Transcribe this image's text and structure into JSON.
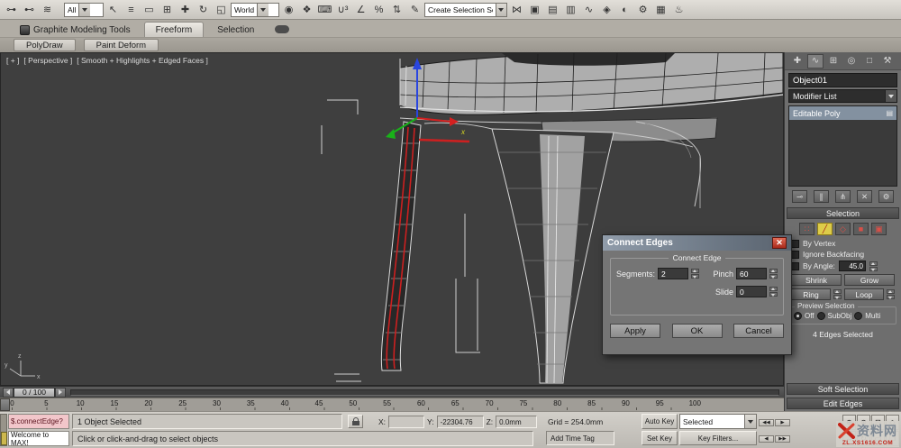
{
  "toolbar": {
    "groups": {
      "g1": [
        {
          "name": "select-and-link-icon",
          "glyph": "⊶"
        },
        {
          "name": "unlink-selection-icon",
          "glyph": "⊷"
        },
        {
          "name": "bind-to-spacewarp-icon",
          "glyph": "≋"
        }
      ],
      "g2": [
        {
          "name": "select-object-icon",
          "glyph": "↖"
        },
        {
          "name": "select-by-name-icon",
          "glyph": "≡"
        },
        {
          "name": "selection-region-icon",
          "glyph": "▭"
        },
        {
          "name": "window-crossing-icon",
          "glyph": "⊞"
        },
        {
          "name": "select-move-icon",
          "glyph": "✚"
        },
        {
          "name": "select-rotate-icon",
          "glyph": "↻"
        },
        {
          "name": "select-scale-icon",
          "glyph": "◱"
        }
      ],
      "g3": [
        {
          "name": "use-pivot-center-icon",
          "glyph": "◉"
        },
        {
          "name": "select-manipulate-icon",
          "glyph": "❖"
        },
        {
          "name": "keyboard-override-icon",
          "glyph": "⌨"
        },
        {
          "name": "snap-toggle-3d-icon",
          "glyph": "∪³"
        },
        {
          "name": "angle-snap-icon",
          "glyph": "∠"
        },
        {
          "name": "percent-snap-icon",
          "glyph": "%"
        },
        {
          "name": "spinner-snap-icon",
          "glyph": "⇅"
        },
        {
          "name": "named-selection-sets-icon",
          "glyph": "✎"
        }
      ],
      "g4": [
        {
          "name": "mirror-icon",
          "glyph": "⋈"
        },
        {
          "name": "align-icon",
          "glyph": "▣"
        },
        {
          "name": "layer-manager-icon",
          "glyph": "▤"
        },
        {
          "name": "graphite-toggle-icon",
          "glyph": "▥"
        },
        {
          "name": "curve-editor-icon",
          "glyph": "∿"
        },
        {
          "name": "schematic-view-icon",
          "glyph": "◈"
        },
        {
          "name": "material-editor-icon",
          "glyph": "◐"
        },
        {
          "name": "render-setup-icon",
          "glyph": "⚙"
        },
        {
          "name": "rendered-frame-icon",
          "glyph": "▦"
        },
        {
          "name": "render-production-icon",
          "glyph": "♨"
        }
      ]
    },
    "filter_dropdown": "All",
    "coord_dropdown": "World",
    "selection_set_dropdown": "Create Selection Se"
  },
  "ribbon": {
    "tabs": [
      {
        "label": "Graphite Modeling Tools"
      },
      {
        "label": "Freeform"
      },
      {
        "label": "Selection"
      }
    ],
    "panels": [
      "PolyDraw",
      "Paint Deform"
    ]
  },
  "viewport": {
    "label_segments": [
      "[ + ]",
      "[ Perspective ]",
      "[ Smooth + Highlights + Edged Faces ]"
    ],
    "gizmo_x_label": "x",
    "axis": {
      "x": "x",
      "y": "y",
      "z": "z"
    }
  },
  "dialog": {
    "title": "Connect Edges",
    "close_glyph": "✕",
    "group_label": "Connect Edge",
    "segments_label": "Segments:",
    "segments_value": "2",
    "pinch_label": "Pinch",
    "pinch_value": "60",
    "slide_label": "Slide",
    "slide_value": "0",
    "apply_label": "Apply",
    "ok_label": "OK",
    "cancel_label": "Cancel"
  },
  "command_panel": {
    "tabs": [
      {
        "name": "create-tab-icon",
        "glyph": "✚"
      },
      {
        "name": "modify-tab-icon",
        "glyph": "∿"
      },
      {
        "name": "hierarchy-tab-icon",
        "glyph": "⊞"
      },
      {
        "name": "motion-tab-icon",
        "glyph": "◎"
      },
      {
        "name": "display-tab-icon",
        "glyph": "□"
      },
      {
        "name": "utilities-tab-icon",
        "glyph": "⚒"
      }
    ],
    "object_name": "Object01",
    "modifier_list_label": "Modifier List",
    "stack_item": "Editable Poly",
    "stack_icon_glyph": "▤",
    "stack_tools": [
      {
        "name": "pin-stack-icon",
        "glyph": "⊸"
      },
      {
        "name": "show-end-result-icon",
        "glyph": "∥"
      },
      {
        "name": "make-unique-icon",
        "glyph": "⋔"
      },
      {
        "name": "remove-modifier-icon",
        "glyph": "✕"
      },
      {
        "name": "configure-modifier-sets-icon",
        "glyph": "⚙"
      }
    ],
    "selection_rollout": {
      "title": "Selection",
      "subobject_icons": [
        {
          "name": "vertex-subobject-icon",
          "glyph": "∷"
        },
        {
          "name": "edge-subobject-icon",
          "glyph": "╱"
        },
        {
          "name": "border-subobject-icon",
          "glyph": "◇"
        },
        {
          "name": "polygon-subobject-icon",
          "glyph": "■"
        },
        {
          "name": "element-subobject-icon",
          "glyph": "▣"
        }
      ],
      "by_vertex_label": "By Vertex",
      "ignore_backfacing_label": "Ignore Backfacing",
      "by_angle_label": "By Angle:",
      "by_angle_value": "45.0",
      "shrink_label": "Shrink",
      "grow_label": "Grow",
      "ring_label": "Ring",
      "loop_label": "Loop",
      "preview_label": "Preview Selection",
      "preview_options": [
        "Off",
        "SubObj",
        "Multi"
      ],
      "status": "4 Edges Selected"
    },
    "soft_selection_title": "Soft Selection",
    "edit_edges_title": "Edit Edges"
  },
  "timeline": {
    "slider_label": "0 / 100",
    "ticks": [
      "0",
      "5",
      "10",
      "15",
      "20",
      "25",
      "30",
      "35",
      "40",
      "45",
      "50",
      "55",
      "60",
      "65",
      "70",
      "75",
      "80",
      "85",
      "90",
      "95",
      "100"
    ]
  },
  "status_bar": {
    "macro_text": "$.connectEdge?",
    "listener_text": "Welcome to MAX!",
    "selection_status": "1 Object Selected",
    "prompt": "Click or click-and-drag to select objects",
    "x_label": "X:",
    "x_value": "",
    "y_label": "Y:",
    "y_value": "-22304.76",
    "z_label": "Z:",
    "z_value": "0.0mm",
    "grid_label": "Grid = 254.0mm",
    "time_tag_label": "Add Time Tag",
    "auto_key_label": "Auto Key",
    "set_key_label": "Set Key",
    "selected_dropdown": "Selected",
    "key_filters_label": "Key Filters...",
    "playback": [
      {
        "name": "goto-start-button",
        "glyph": "◀◀"
      },
      {
        "name": "play-button",
        "glyph": "▶"
      },
      {
        "name": "prev-frame-button",
        "glyph": "◀"
      },
      {
        "name": "goto-end-button",
        "glyph": "▶▶"
      }
    ],
    "nav": [
      {
        "name": "zoom-icon",
        "glyph": "⊕"
      },
      {
        "name": "zoom-all-icon",
        "glyph": "⊛"
      },
      {
        "name": "zoom-extents-icon",
        "glyph": "⊡"
      },
      {
        "name": "fov-icon",
        "glyph": "◇"
      },
      {
        "name": "pan-icon",
        "glyph": "↔"
      },
      {
        "name": "orbit-icon",
        "glyph": "↻"
      },
      {
        "name": "zoom-region-icon",
        "glyph": "▭"
      },
      {
        "name": "maximize-viewport-icon",
        "glyph": "❒"
      }
    ]
  },
  "watermark": {
    "site_name": "资料网",
    "url": "ZL.XS1616.COM"
  }
}
